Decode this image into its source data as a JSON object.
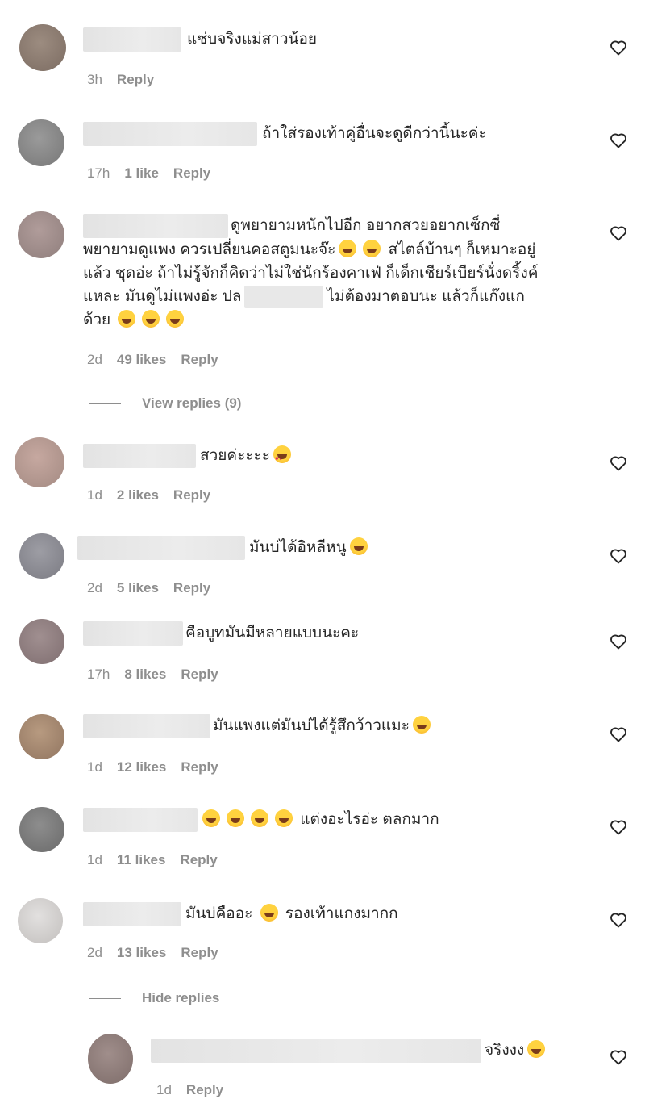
{
  "comments": [
    {
      "text": "แซ่บจริงแม่สาวน้อย",
      "time": "3h",
      "likes": "",
      "reply": "Reply",
      "avatar_color": "#8a7b6f"
    },
    {
      "text": "ถ้าใส่รองเท้าคู่อื่นจะดูดีกว่านี้นะค่ะ",
      "time": "17h",
      "likes": "1 like",
      "reply": "Reply",
      "avatar_color": "#8f8f8f"
    },
    {
      "text_l1": "ดูพยายามหนักไปอีก อยากสวยอยากเซ็กซี่",
      "text_l2": "พยายามดูแพง ควรเปลี่ยนคอสตูมนะจ๊ะ",
      "text_l2b": "สไตล์บ้านๆ ก็เหมาะอยู่",
      "text_l3": "แล้ว ชุดอ่ะ ถ้าไม่รู้จักก็คิดว่าไม่ใช่นักร้องคาเฟ่ ก็เด็กเชียร์เบียร์นั่งดริ้งค์",
      "text_l4a": "แหละ มันดูไม่แพงอ่ะ ปล",
      "text_l4b": "ไม่ต้องมาตอบนะ แล้วก็แก๊งแก",
      "text_l5": "ด้วย",
      "time": "2d",
      "likes": "49 likes",
      "reply": "Reply",
      "avatar_color": "#a49190"
    },
    {
      "text": "สวยค่ะะะะ",
      "time": "1d",
      "likes": "2 likes",
      "reply": "Reply",
      "avatar_color": "#b59890"
    },
    {
      "text": "มันบ่ได้อิหลีหนู",
      "time": "2d",
      "likes": "5 likes",
      "reply": "Reply",
      "avatar_color": "#8c8c94"
    },
    {
      "text": "คือบูทมันมีหลายแบบนะคะ",
      "time": "17h",
      "likes": "8 likes",
      "reply": "Reply",
      "avatar_color": "#907f80"
    },
    {
      "text": "มันแพงแต่มันบ่ได้รู้สึกว้าวแมะ",
      "time": "1d",
      "likes": "12 likes",
      "reply": "Reply",
      "avatar_color": "#a88a70"
    },
    {
      "text": "แต่งอะไรอ่ะ ตลกมาก",
      "time": "1d",
      "likes": "11 likes",
      "reply": "Reply",
      "avatar_color": "#7d7d7d"
    },
    {
      "text_a": "มันบ่คืออะ",
      "text_b": "รองเท้าแกงมากก",
      "time": "2d",
      "likes": "13 likes",
      "reply": "Reply",
      "avatar_color": "#d2d0cf"
    }
  ],
  "view_replies": "View replies (9)",
  "hide_replies": "Hide replies",
  "reply_comment": {
    "text": "จริงงง",
    "time": "1d",
    "reply": "Reply",
    "avatar_color": "#8f7f7c"
  },
  "icons": {
    "like": "heart-outline-icon",
    "emoji_laugh": "tears-of-joy-emoji",
    "emoji_love": "heart-eyes-emoji"
  }
}
